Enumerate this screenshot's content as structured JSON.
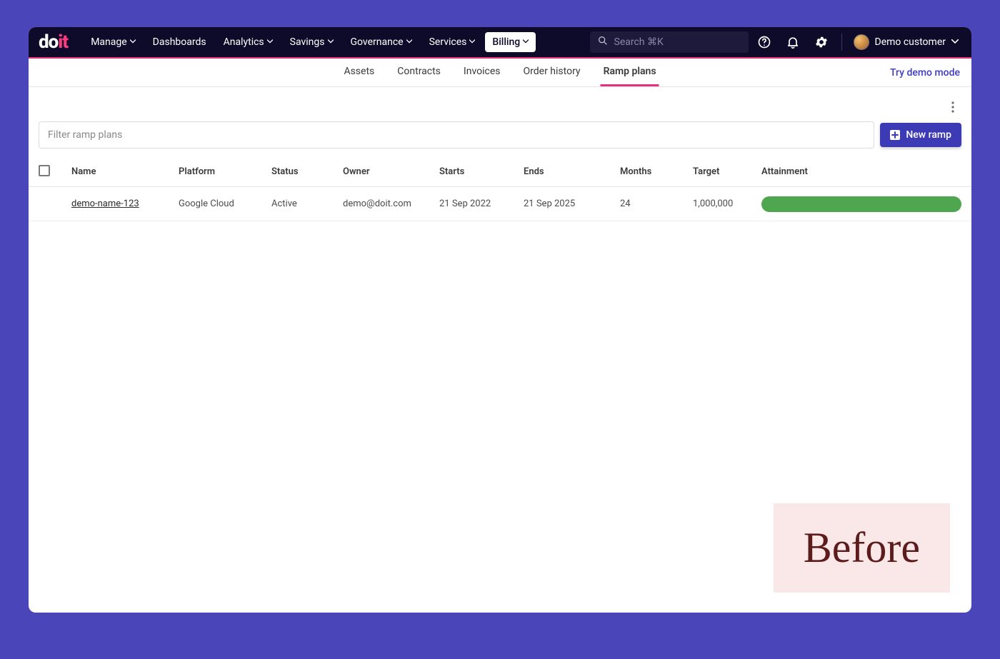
{
  "nav": {
    "items": [
      "Manage",
      "Dashboards",
      "Analytics",
      "Savings",
      "Governance",
      "Services",
      "Billing"
    ],
    "active": "Billing"
  },
  "search": {
    "placeholder": "Search ⌘K"
  },
  "user": {
    "name": "Demo customer"
  },
  "tabs": {
    "items": [
      "Assets",
      "Contracts",
      "Invoices",
      "Order history",
      "Ramp plans"
    ],
    "active": "Ramp plans",
    "demo_mode": "Try demo mode"
  },
  "filter": {
    "placeholder": "Filter ramp plans"
  },
  "new_ramp_label": "New ramp",
  "columns": [
    "Name",
    "Platform",
    "Status",
    "Owner",
    "Starts",
    "Ends",
    "Months",
    "Target",
    "Attainment"
  ],
  "rows": [
    {
      "name": "demo-name-123",
      "platform": "Google Cloud",
      "status": "Active",
      "owner": "demo@doit.com",
      "starts": "21 Sep 2022",
      "ends": "21 Sep 2025",
      "months": "24",
      "target": "1,000,000"
    }
  ],
  "overlay": {
    "label": "Before"
  },
  "logo": {
    "part1": "do",
    "part2": "it"
  }
}
